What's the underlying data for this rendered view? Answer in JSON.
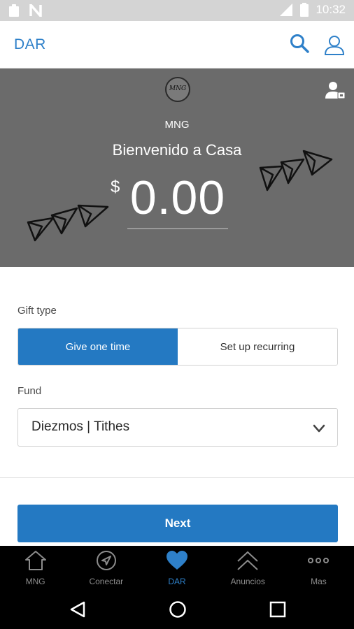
{
  "status_bar": {
    "time": "10:32",
    "icons": [
      "clipboard-icon",
      "n-app-icon",
      "signal-icon",
      "battery-icon"
    ]
  },
  "header": {
    "title": "DAR",
    "icons": [
      "search-icon",
      "user-icon"
    ]
  },
  "hero": {
    "logo_text": "MNG",
    "org_name": "MNG",
    "welcome": "Bienvenido a Casa",
    "currency_symbol": "$",
    "amount": "0.00"
  },
  "form": {
    "gift_type_label": "Gift type",
    "gift_options": [
      "Give one time",
      "Set up recurring"
    ],
    "selected_gift_option": "Give one time",
    "fund_label": "Fund",
    "fund_value": "Diezmos | Tithes",
    "next_label": "Next"
  },
  "tabs": [
    {
      "label": "MNG",
      "icon": "home-icon",
      "active": false
    },
    {
      "label": "Conectar",
      "icon": "compass-icon",
      "active": false
    },
    {
      "label": "DAR",
      "icon": "heart-icon",
      "active": true
    },
    {
      "label": "Anuncios",
      "icon": "double-chevron-up-icon",
      "active": false
    },
    {
      "label": "Mas",
      "icon": "more-icon",
      "active": false
    }
  ],
  "colors": {
    "accent": "#2479c2",
    "hero_bg": "#6b6b6b",
    "tab_active": "#2e80c9"
  }
}
